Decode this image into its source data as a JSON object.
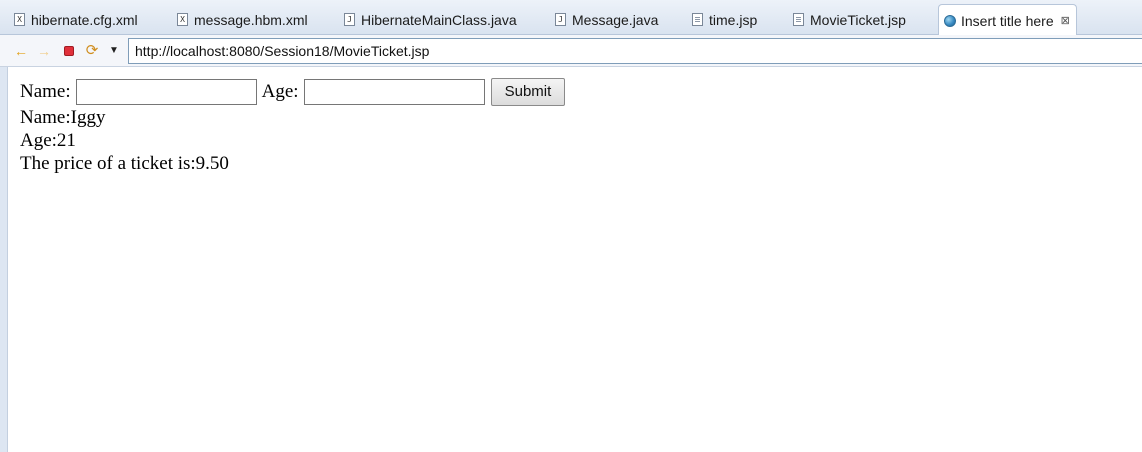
{
  "tabs": [
    {
      "label": "hibernate.cfg.xml",
      "icon": "xml-file-icon",
      "glyph": "X"
    },
    {
      "label": "message.hbm.xml",
      "icon": "xml-file-icon",
      "glyph": "X"
    },
    {
      "label": "HibernateMainClass.java",
      "icon": "java-file-icon",
      "glyph": "J"
    },
    {
      "label": "Message.java",
      "icon": "java-file-icon",
      "glyph": "J"
    },
    {
      "label": "time.jsp",
      "icon": "jsp-file-icon",
      "glyph": ""
    },
    {
      "label": "MovieTicket.jsp",
      "icon": "jsp-file-icon",
      "glyph": ""
    },
    {
      "label": "Insert title here",
      "icon": "globe-icon",
      "close_glyph": "⊠"
    }
  ],
  "toolbar": {
    "back_icon": "←",
    "forward_icon": "→",
    "refresh_icon": "⟳",
    "dropdown_icon": "▼",
    "url": "http://localhost:8080/Session18/MovieTicket.jsp"
  },
  "form": {
    "name_label": "Name:",
    "name_value": "",
    "age_label": "Age:",
    "age_value": "",
    "submit_label": "Submit"
  },
  "result": {
    "name_line": "Name:Iggy",
    "age_line": "Age:21",
    "price_line": "The price of a ticket is:9.50"
  },
  "colors": {
    "tabbar_bg": "#dde6f2",
    "url_border": "#7f9db9",
    "stop_red": "#e0303a"
  }
}
